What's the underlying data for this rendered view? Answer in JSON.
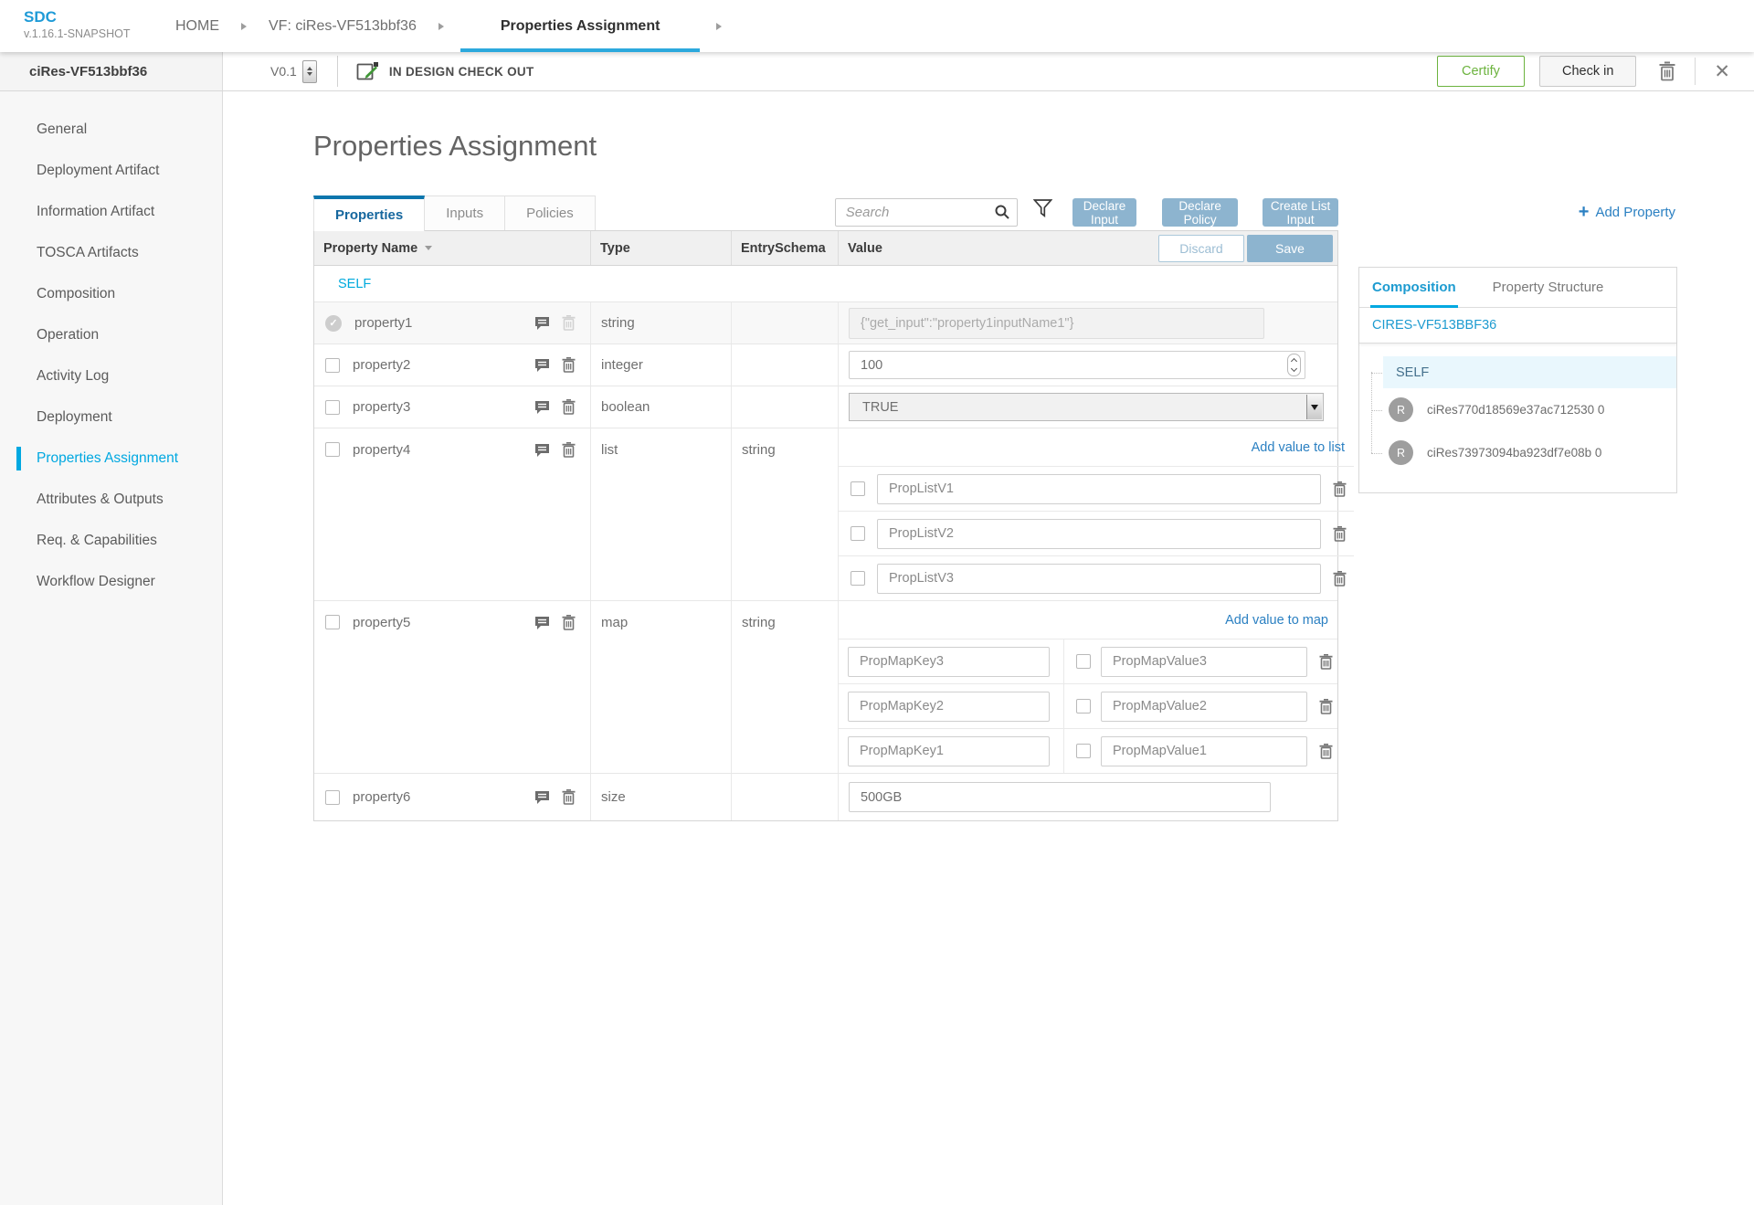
{
  "header": {
    "logo_title": "SDC",
    "logo_version": "v.1.16.1-SNAPSHOT",
    "breadcrumbs": [
      "HOME",
      "VF: ciRes-VF513bbf36",
      "Properties Assignment"
    ]
  },
  "workspace": {
    "entity_name": "ciRes-VF513bbf36",
    "version": "V0.1",
    "status": "IN DESIGN CHECK OUT",
    "certify_label": "Certify",
    "checkin_label": "Check in"
  },
  "sidebar": {
    "items": [
      {
        "label": "General"
      },
      {
        "label": "Deployment Artifact"
      },
      {
        "label": "Information Artifact"
      },
      {
        "label": "TOSCA Artifacts"
      },
      {
        "label": "Composition"
      },
      {
        "label": "Operation"
      },
      {
        "label": "Activity Log"
      },
      {
        "label": "Deployment"
      },
      {
        "label": "Properties Assignment"
      },
      {
        "label": "Attributes & Outputs"
      },
      {
        "label": "Req. & Capabilities"
      },
      {
        "label": "Workflow Designer"
      }
    ]
  },
  "page": {
    "title": "Properties Assignment",
    "tabs": [
      {
        "label": "Properties"
      },
      {
        "label": "Inputs"
      },
      {
        "label": "Policies"
      }
    ],
    "search_placeholder": "Search",
    "declare_input_label": "Declare Input",
    "declare_policy_label": "Declare Policy",
    "create_list_input_label": "Create List Input",
    "add_property_label": "Add Property",
    "add_property_plus": "+"
  },
  "table": {
    "columns": {
      "name": "Property Name",
      "type": "Type",
      "entry_schema": "EntrySchema",
      "value": "Value"
    },
    "discard_label": "Discard",
    "save_label": "Save",
    "self_label": "SELF",
    "rows": [
      {
        "name": "property1",
        "type": "string",
        "entry_schema": "",
        "value": "{\"get_input\":\"property1inputName1\"}"
      },
      {
        "name": "property2",
        "type": "integer",
        "entry_schema": "",
        "value": "100"
      },
      {
        "name": "property3",
        "type": "boolean",
        "entry_schema": "",
        "value": "TRUE"
      },
      {
        "name": "property4",
        "type": "list",
        "entry_schema": "string",
        "add_label": "Add value to list",
        "items": [
          "PropListV1",
          "PropListV2",
          "PropListV3"
        ]
      },
      {
        "name": "property5",
        "type": "map",
        "entry_schema": "string",
        "add_label": "Add value to map",
        "entries": [
          {
            "key": "PropMapKey3",
            "value": "PropMapValue3"
          },
          {
            "key": "PropMapKey2",
            "value": "PropMapValue2"
          },
          {
            "key": "PropMapKey1",
            "value": "PropMapValue1"
          }
        ]
      },
      {
        "name": "property6",
        "type": "size",
        "entry_schema": "",
        "value": "500GB"
      }
    ]
  },
  "right_panel": {
    "tabs": [
      {
        "label": "Composition"
      },
      {
        "label": "Property Structure"
      }
    ],
    "root_label": "CIRES-VF513BBF36",
    "self_label": "SELF",
    "instances": [
      {
        "initial": "R",
        "label": "ciRes770d18569e37ac712530 0"
      },
      {
        "initial": "R",
        "label": "ciRes73973094ba923df7e08b 0"
      }
    ]
  },
  "colors": {
    "primary_blue": "#00a8e1",
    "tab_dark_blue": "#0d76ad",
    "steel_blue_button": "#8db4cf",
    "certify_green": "#6cb33e"
  }
}
